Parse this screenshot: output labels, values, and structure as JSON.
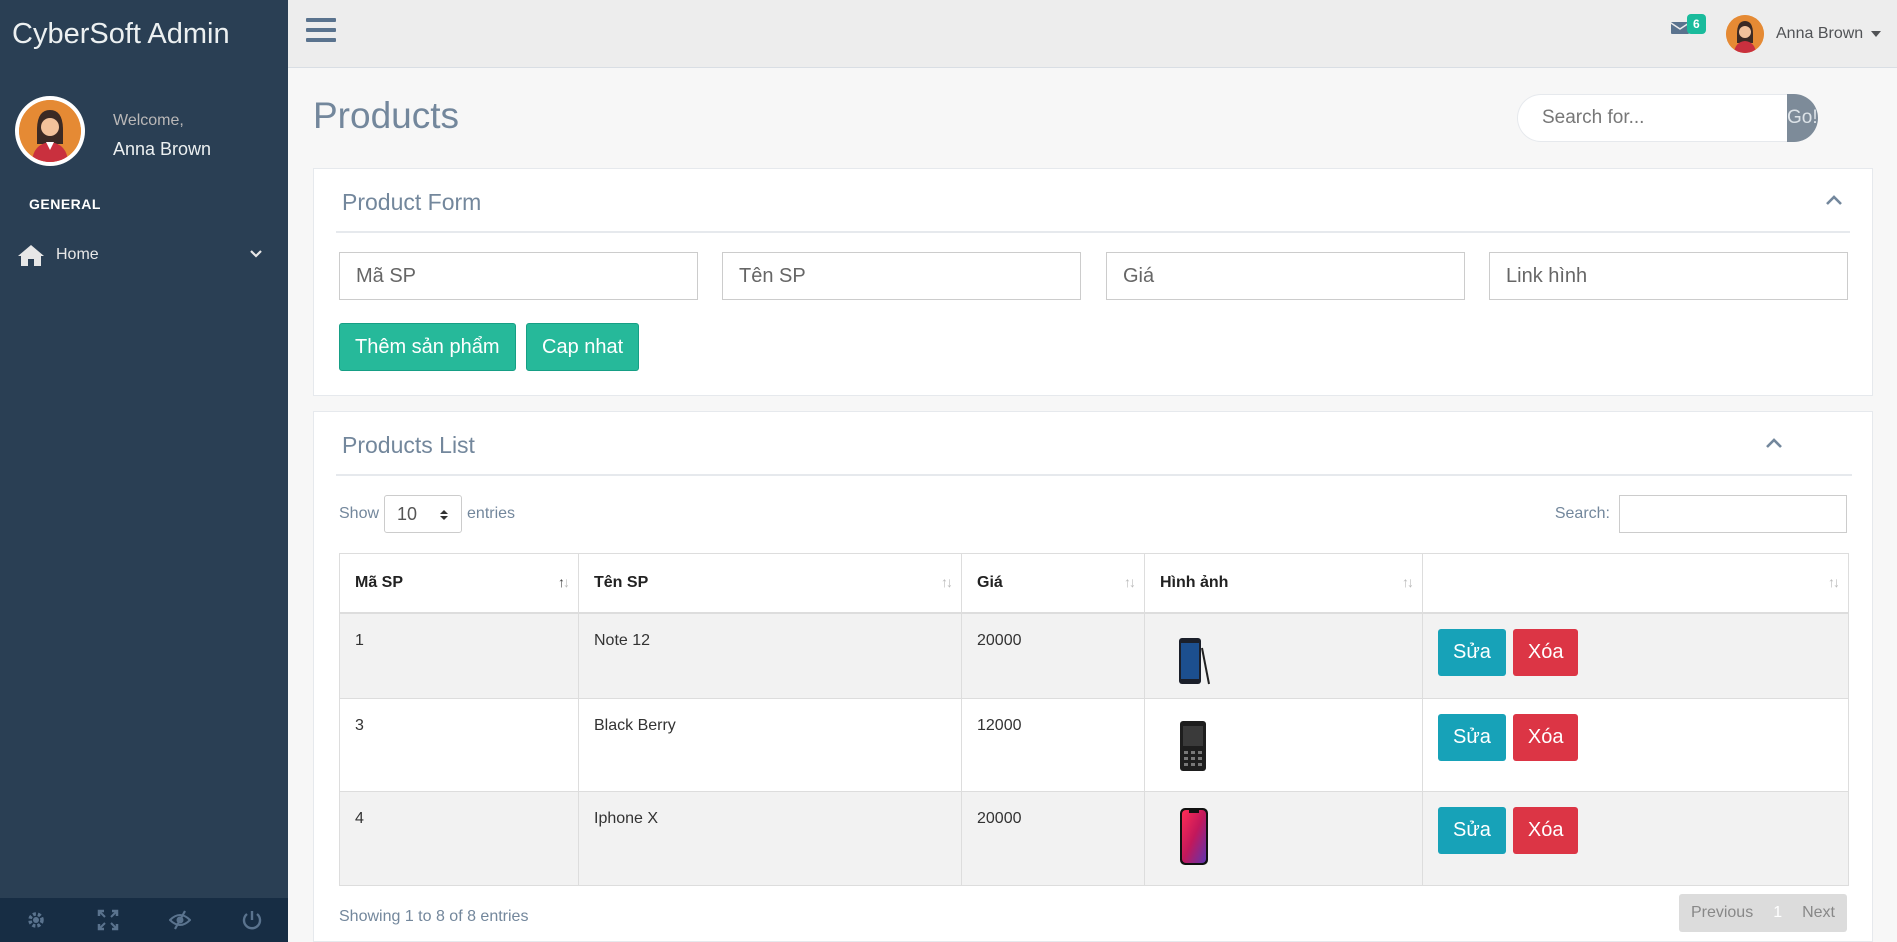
{
  "sidebar": {
    "brand": "CyberSoft Admin",
    "welcome": "Welcome,",
    "user_name": "Anna Brown",
    "section_title": "GENERAL",
    "nav_home": "Home",
    "footer_icons": [
      "gear-icon",
      "fullscreen-icon",
      "eye-slash-icon",
      "power-icon"
    ]
  },
  "topnav": {
    "mail_count": "6",
    "user_name": "Anna Brown"
  },
  "page": {
    "title": "Products",
    "search_placeholder": "Search for...",
    "search_button": "Go!"
  },
  "product_form": {
    "title": "Product Form",
    "fields": {
      "code_placeholder": "Mã SP",
      "name_placeholder": "Tên SP",
      "price_placeholder": "Giá",
      "image_placeholder": "Link hình"
    },
    "add_button": "Thêm sản phẩm",
    "update_button": "Cap nhat"
  },
  "products_list": {
    "title": "Products List",
    "show_label": "Show",
    "page_size": "10",
    "entries_label": "entries",
    "search_label": "Search:",
    "columns": [
      "Mã SP",
      "Tên SP",
      "Giá",
      "Hình ảnh",
      ""
    ],
    "rows": [
      {
        "code": "1",
        "name": "Note 12",
        "price": "20000",
        "image": "phone-note"
      },
      {
        "code": "3",
        "name": "Black Berry",
        "price": "12000",
        "image": "phone-blackberry"
      },
      {
        "code": "4",
        "name": "Iphone X",
        "price": "20000",
        "image": "phone-iphone"
      }
    ],
    "edit_label": "Sửa",
    "delete_label": "Xóa",
    "info": "Showing 1 to 8 of 8 entries",
    "previous": "Previous",
    "current_page": "1",
    "next": "Next"
  },
  "colors": {
    "sidebar": "#2a3f54",
    "success": "#26b99a",
    "edit": "#17a2b8",
    "delete": "#dc3545"
  }
}
